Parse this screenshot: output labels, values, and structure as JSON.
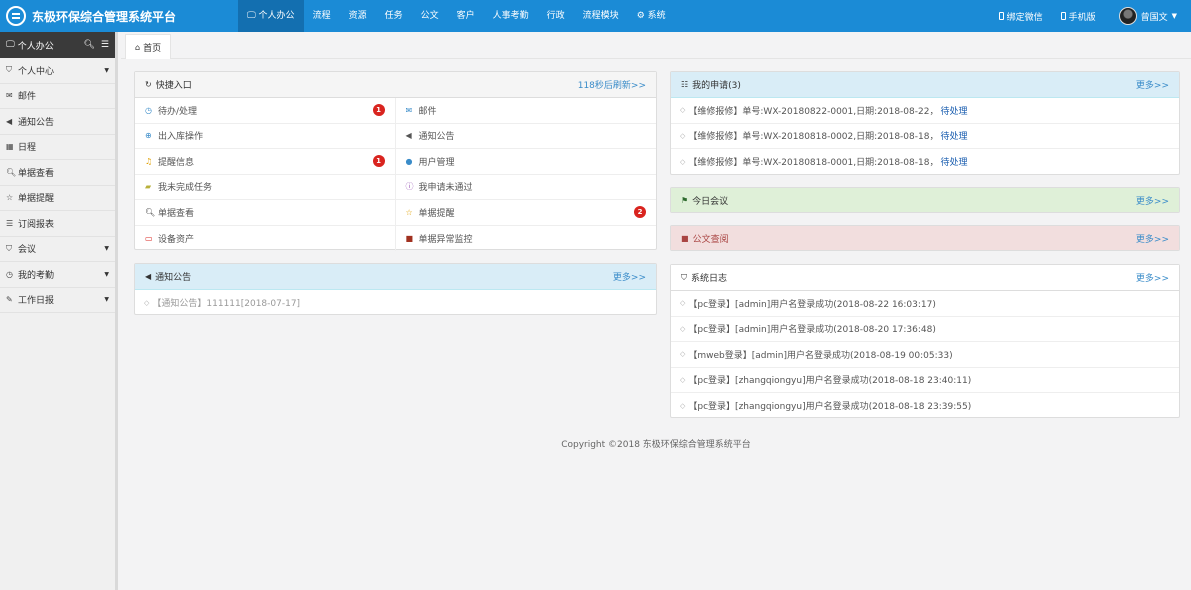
{
  "app": {
    "title": "东极环保综合管理系统平台"
  },
  "topnav": [
    {
      "label": "个人办公",
      "icon": "monitor-icon",
      "active": true
    },
    {
      "label": "流程"
    },
    {
      "label": "资源"
    },
    {
      "label": "任务"
    },
    {
      "label": "公文"
    },
    {
      "label": "客户"
    },
    {
      "label": "人事考勤"
    },
    {
      "label": "行政"
    },
    {
      "label": "流程模块"
    },
    {
      "label": "系统",
      "icon": "gear-icon"
    }
  ],
  "topright": {
    "wechat": "绑定微信",
    "mobile": "手机版",
    "user": "曾国文"
  },
  "sidebar": {
    "title": "个人办公",
    "items": [
      {
        "label": "个人中心",
        "icon": "bookmark-icon",
        "submenu": true
      },
      {
        "label": "邮件",
        "icon": "envelope-icon"
      },
      {
        "label": "通知公告",
        "icon": "volume-icon"
      },
      {
        "label": "日程",
        "icon": "calendar-icon"
      },
      {
        "label": "单据查看",
        "icon": "search-icon"
      },
      {
        "label": "单据提醒",
        "icon": "star-icon"
      },
      {
        "label": "订阅报表",
        "icon": "rss-icon"
      },
      {
        "label": "会议",
        "icon": "bookmark-icon",
        "submenu": true
      },
      {
        "label": "我的考勤",
        "icon": "clock-icon",
        "submenu": true
      },
      {
        "label": "工作日报",
        "icon": "edit-icon",
        "submenu": true
      }
    ]
  },
  "tabs": [
    {
      "label": "首页"
    }
  ],
  "quick": {
    "title": "快捷入口",
    "refresh": "118秒后刷新>>",
    "items": [
      {
        "label": "待办/处理",
        "icon": "clock-icon",
        "color": "#3a8cc9",
        "badge": "1"
      },
      {
        "label": "邮件",
        "icon": "envelope-icon",
        "color": "#3a8cc9",
        "badge": ""
      },
      {
        "label": "出入库操作",
        "icon": "plus-circle-icon",
        "color": "#3a8cc9",
        "badge": ""
      },
      {
        "label": "通知公告",
        "icon": "volume-icon",
        "color": "#555555",
        "badge": ""
      },
      {
        "label": "提醒信息",
        "icon": "bell-icon",
        "color": "#e0a000",
        "badge": "1"
      },
      {
        "label": "用户管理",
        "icon": "user-icon",
        "color": "#3a8cc9",
        "badge": ""
      },
      {
        "label": "我未完成任务",
        "icon": "book-icon",
        "color": "#b8b03a",
        "badge": ""
      },
      {
        "label": "我申请未通过",
        "icon": "info-icon",
        "color": "#9b59b6",
        "badge": ""
      },
      {
        "label": "单据查看",
        "icon": "search-icon",
        "color": "#333333",
        "badge": ""
      },
      {
        "label": "单据提醒",
        "icon": "star-icon",
        "color": "#e0a000",
        "badge": "2"
      },
      {
        "label": "设备资产",
        "icon": "laptop-icon",
        "color": "#d9241f",
        "badge": ""
      },
      {
        "label": "单据异常监控",
        "icon": "briefcase-icon",
        "color": "#a0301f",
        "badge": ""
      }
    ]
  },
  "notice": {
    "title": "通知公告",
    "more": "更多>>",
    "items": [
      {
        "text": "【通知公告】111111[2018-07-17]"
      }
    ]
  },
  "myapply": {
    "title": "我的申请(3)",
    "more": "更多>>",
    "items": [
      {
        "text": "【维修报修】单号:WX-20180822-0001,日期:2018-08-22，",
        "link": "待处理"
      },
      {
        "text": "【维修报修】单号:WX-20180818-0002,日期:2018-08-18，",
        "link": "待处理"
      },
      {
        "text": "【维修报修】单号:WX-20180818-0001,日期:2018-08-18，",
        "link": "待处理"
      }
    ]
  },
  "meeting": {
    "title": "今日会议",
    "more": "更多>>"
  },
  "docquery": {
    "title": "公文查阅",
    "more": "更多>>"
  },
  "syslog": {
    "title": "系统日志",
    "more": "更多>>",
    "items": [
      {
        "text": "【pc登录】[admin]用户名登录成功(2018-08-22 16:03:17)"
      },
      {
        "text": "【pc登录】[admin]用户名登录成功(2018-08-20 17:36:48)"
      },
      {
        "text": "【mweb登录】[admin]用户名登录成功(2018-08-19 00:05:33)"
      },
      {
        "text": "【pc登录】[zhangqiongyu]用户名登录成功(2018-08-18 23:40:11)"
      },
      {
        "text": "【pc登录】[zhangqiongyu]用户名登录成功(2018-08-18 23:39:55)"
      }
    ]
  },
  "footer": {
    "text": "Copyright ©2018    东极环保综合管理系统平台"
  },
  "colors": {
    "topbar": "#1b8bd6",
    "active_nav": "#136fb0",
    "badge": "#d9241f",
    "link": "#1c5fb0"
  }
}
